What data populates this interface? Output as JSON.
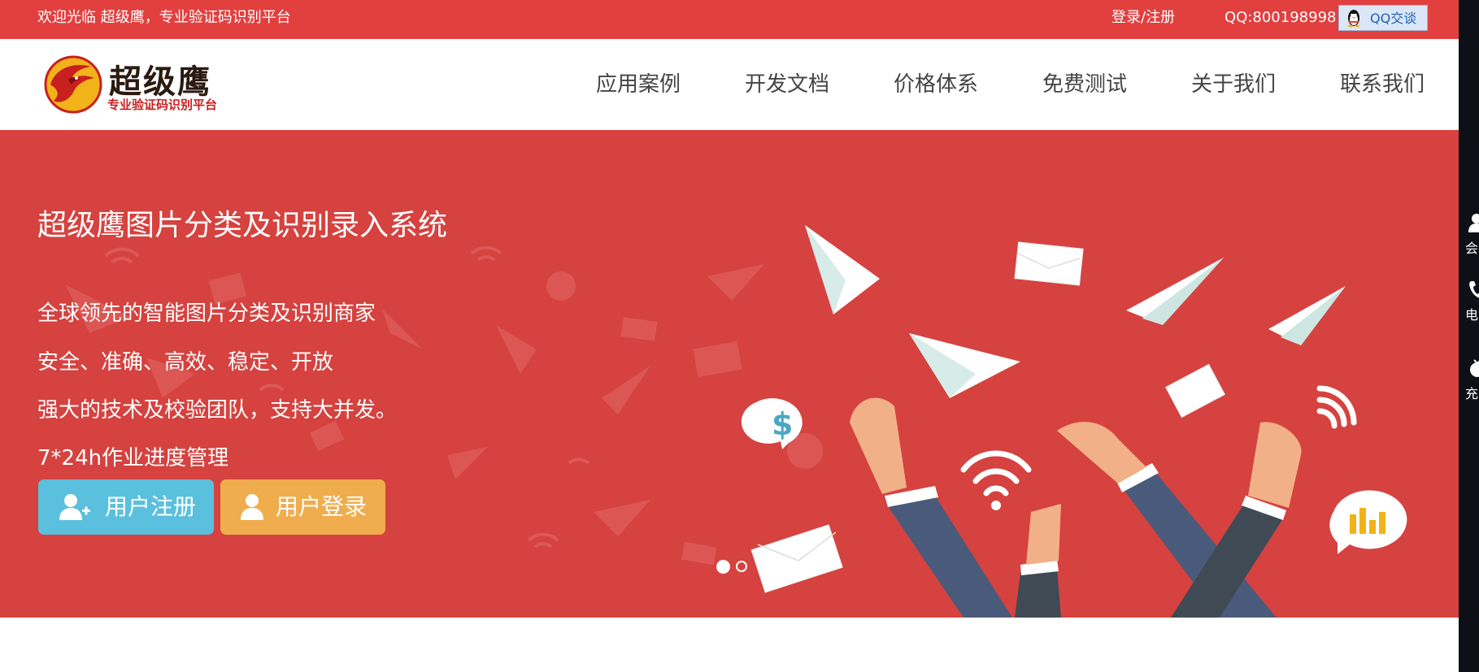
{
  "topbar": {
    "welcome": "欢迎光临 超级鹰，专业验证码识别平台",
    "login_register": "登录/注册",
    "qq_number": "QQ:800198998",
    "qq_chat_button": "QQ交谈"
  },
  "header": {
    "logo_title": "超级鹰",
    "logo_subtitle": "专业验证码识别平台",
    "nav": [
      "应用案例",
      "开发文档",
      "价格体系",
      "免费测试",
      "关于我们",
      "联系我们"
    ]
  },
  "hero": {
    "title": "超级鹰图片分类及识别录入系统",
    "lines": [
      "全球领先的智能图片分类及识别商家",
      "安全、准确、高效、稳定、开放",
      "强大的技术及校验团队，支持大并发。",
      "7*24h作业进度管理"
    ],
    "register_button": "用户注册",
    "login_button": "用户登录",
    "carousel": {
      "active_slide": 1,
      "total_slides": 2
    }
  },
  "sidebar": {
    "items": [
      "会",
      "电",
      "充"
    ]
  },
  "colors": {
    "topbar": "#e23f3f",
    "hero": "#d5423f",
    "register": "#5bc0de",
    "login": "#f0ad4e",
    "sidebar": "#0d1117"
  },
  "icons": {
    "qq": "qq-penguin-icon",
    "register": "user-add-icon",
    "login": "user-icon",
    "sidebar": [
      "user-icon",
      "phone-icon",
      "wallet-icon"
    ]
  }
}
